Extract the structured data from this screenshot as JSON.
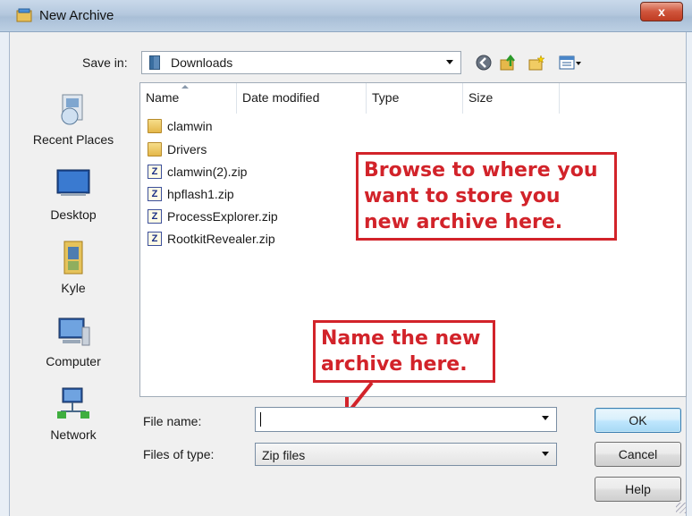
{
  "window": {
    "title": "New Archive",
    "close_label": "x"
  },
  "toolbar": {
    "save_in_label": "Save in:",
    "save_in_value": "Downloads"
  },
  "places": [
    {
      "label": "Recent Places"
    },
    {
      "label": "Desktop"
    },
    {
      "label": "Kyle"
    },
    {
      "label": "Computer"
    },
    {
      "label": "Network"
    }
  ],
  "filelist": {
    "columns": [
      "Name",
      "Date modified",
      "Type",
      "Size"
    ],
    "items": [
      {
        "name": "clamwin",
        "kind": "folder"
      },
      {
        "name": "Drivers",
        "kind": "folder"
      },
      {
        "name": "clamwin(2).zip",
        "kind": "zip"
      },
      {
        "name": "hpflash1.zip",
        "kind": "zip"
      },
      {
        "name": "ProcessExplorer.zip",
        "kind": "zip"
      },
      {
        "name": "RootkitRevealer.zip",
        "kind": "zip"
      }
    ]
  },
  "annotations": {
    "browse_lines": [
      "Browse to where you",
      "want to store you",
      "new archive here."
    ],
    "name_lines": [
      "Name the new",
      "archive here."
    ],
    "color": "#d2232a"
  },
  "form": {
    "file_name_label": "File name:",
    "file_name_value": "",
    "file_type_label": "Files of type:",
    "file_type_value": "Zip files"
  },
  "buttons": {
    "ok": "OK",
    "cancel": "Cancel",
    "help": "Help"
  }
}
